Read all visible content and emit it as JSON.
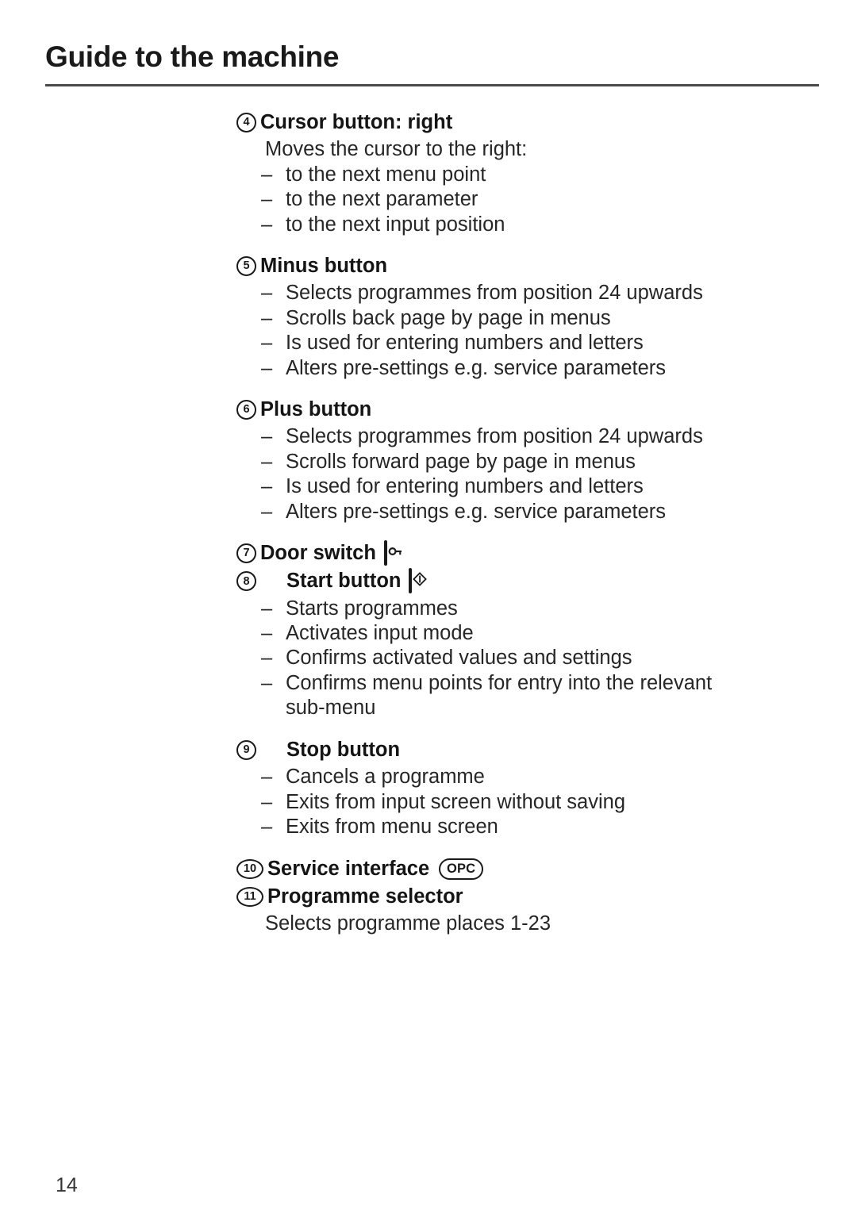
{
  "document": {
    "title": "Guide to the machine",
    "page_number": "14"
  },
  "entries": [
    {
      "number": "4",
      "heading": "Cursor button: right",
      "icon": "cursor-right-icon",
      "indented": false,
      "intro": "Moves the cursor to the right:",
      "bullets": [
        "to the next menu point",
        "to the next parameter",
        "to the next input position"
      ]
    },
    {
      "number": "5",
      "heading": "Minus button",
      "icon": "minus-icon",
      "indented": false,
      "intro": "",
      "bullets": [
        "Selects programmes from position 24 upwards",
        "Scrolls back page by page in menus",
        "Is used for entering numbers and letters",
        "Alters pre-settings e.g. service parameters"
      ]
    },
    {
      "number": "6",
      "heading": "Plus button",
      "icon": "plus-icon",
      "indented": false,
      "intro": "",
      "bullets": [
        "Selects programmes from position 24 upwards",
        "Scrolls forward page by page in menus",
        "Is used for entering numbers and letters",
        "Alters pre-settings e.g. service parameters"
      ]
    },
    {
      "number": "7",
      "heading": "Door switch",
      "icon": "key-icon",
      "indented": false,
      "intro": "",
      "bullets": []
    },
    {
      "number": "8",
      "heading": "Start button",
      "icon": "start-icon",
      "indented": true,
      "intro": "",
      "bullets": [
        "Starts programmes",
        "Activates input mode",
        "Confirms activated values and settings",
        "Confirms menu points for entry into the relevant"
      ],
      "bullet_continuation": "sub-menu"
    },
    {
      "number": "9",
      "heading": "Stop button",
      "icon": "stop-icon",
      "indented": true,
      "intro": "",
      "bullets": [
        "Cancels a programme",
        "Exits from input screen without saving",
        "Exits from menu screen"
      ]
    },
    {
      "number": "10",
      "heading": "Service interface",
      "icon": "opc-icon",
      "icon_label": "OPC",
      "indented": false,
      "intro": "",
      "bullets": []
    },
    {
      "number": "11",
      "heading": "Programme selector",
      "icon": "",
      "indented": false,
      "intro": "Selects programme places 1-23",
      "bullets": []
    }
  ],
  "bullet_marker": "–",
  "colors": {
    "text": "#1a1a1a",
    "body_text": "#262626",
    "rule": "#4a4a4a",
    "icon_dark": "#1a1a1a",
    "page_background": "#ffffff"
  }
}
